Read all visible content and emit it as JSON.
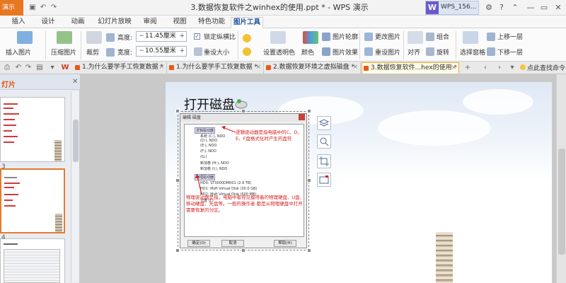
{
  "titlebar": {
    "app_menu": "演示",
    "title": "3.数据恢复软件之winhex的使用.ppt * - WPS 演示",
    "user_badge": "W",
    "user_label": "WPS_156..."
  },
  "menu_tabs": [
    "插入",
    "设计",
    "动画",
    "幻灯片放映",
    "审阅",
    "视图",
    "特色功能",
    "图片工具"
  ],
  "active_tab": "图片工具",
  "ribbon": {
    "insert_picture": "插入图片",
    "compress_picture": "压缩图片",
    "crop": "裁剪",
    "height_label": "高度:",
    "height_value": "11.45厘米",
    "width_label": "宽度:",
    "width_value": "10.55厘米",
    "lock_aspect": "锁定纵横比",
    "reset_size": "重设大小",
    "set_transparent": "设置透明色",
    "color": "颜色",
    "picture_outline": "图片轮廓",
    "picture_effects": "图片效果",
    "change_picture": "更改图片",
    "reset_picture": "重设图片",
    "align": "对齐",
    "combine": "组合",
    "rotate": "旋转",
    "selection_pane": "选择窗格",
    "bring_forward": "上移一层",
    "send_backward": "下移一层"
  },
  "doc_tabs": [
    "1.为什么要学手工恢复数据 *",
    "1.为什么要学手工恢复数据 *",
    "2.数据恢复环境之虚拟磁盘 *",
    "3.数据恢复软件...hex的使用 *"
  ],
  "help_search": "点此查找命令",
  "left_panel": {
    "title": "灯片",
    "thumb_numbers": [
      "3",
      "4"
    ]
  },
  "slide": {
    "title": "打开磁盘",
    "dialog": {
      "title": "编辑 磁盘",
      "logical_header": "逻辑驱动器",
      "logical_items": [
        "系统 (C:), NDO",
        "(D:), NDO",
        "(E:), NDO",
        "(F:), NDO",
        "(G:)",
        "新加卷 (H:), NDO",
        "新加卷 (I:), NDO"
      ],
      "physical_header": "物理驱动器",
      "physical_items": [
        "HD0: ST3000DM001 (2.9 TB)",
        "HD1: Msft    Virtual Disk (30.0 GB)",
        "HD2: Msft    Virtual Disk (500 MB)",
        "光盘 (J:)"
      ],
      "annotation_logical": "逻辑驱动器是指电脑中的C、D、E、F盘格式化时产生的盘符",
      "annotation_physical": "物理驱动器是指，电脑中看得见摸得着的物理硬盘、U盘、移动硬盘、光盘等。一般的操作者 都是从物理硬盘中打开需要恢复的分区。",
      "ok": "确定(O)",
      "cancel": "取消",
      "help": "帮助(H)"
    }
  },
  "colors": {
    "accent_orange": "#e8792b",
    "annotation_red": "#d42020",
    "active_tab_blue": "#1f4f9f"
  }
}
